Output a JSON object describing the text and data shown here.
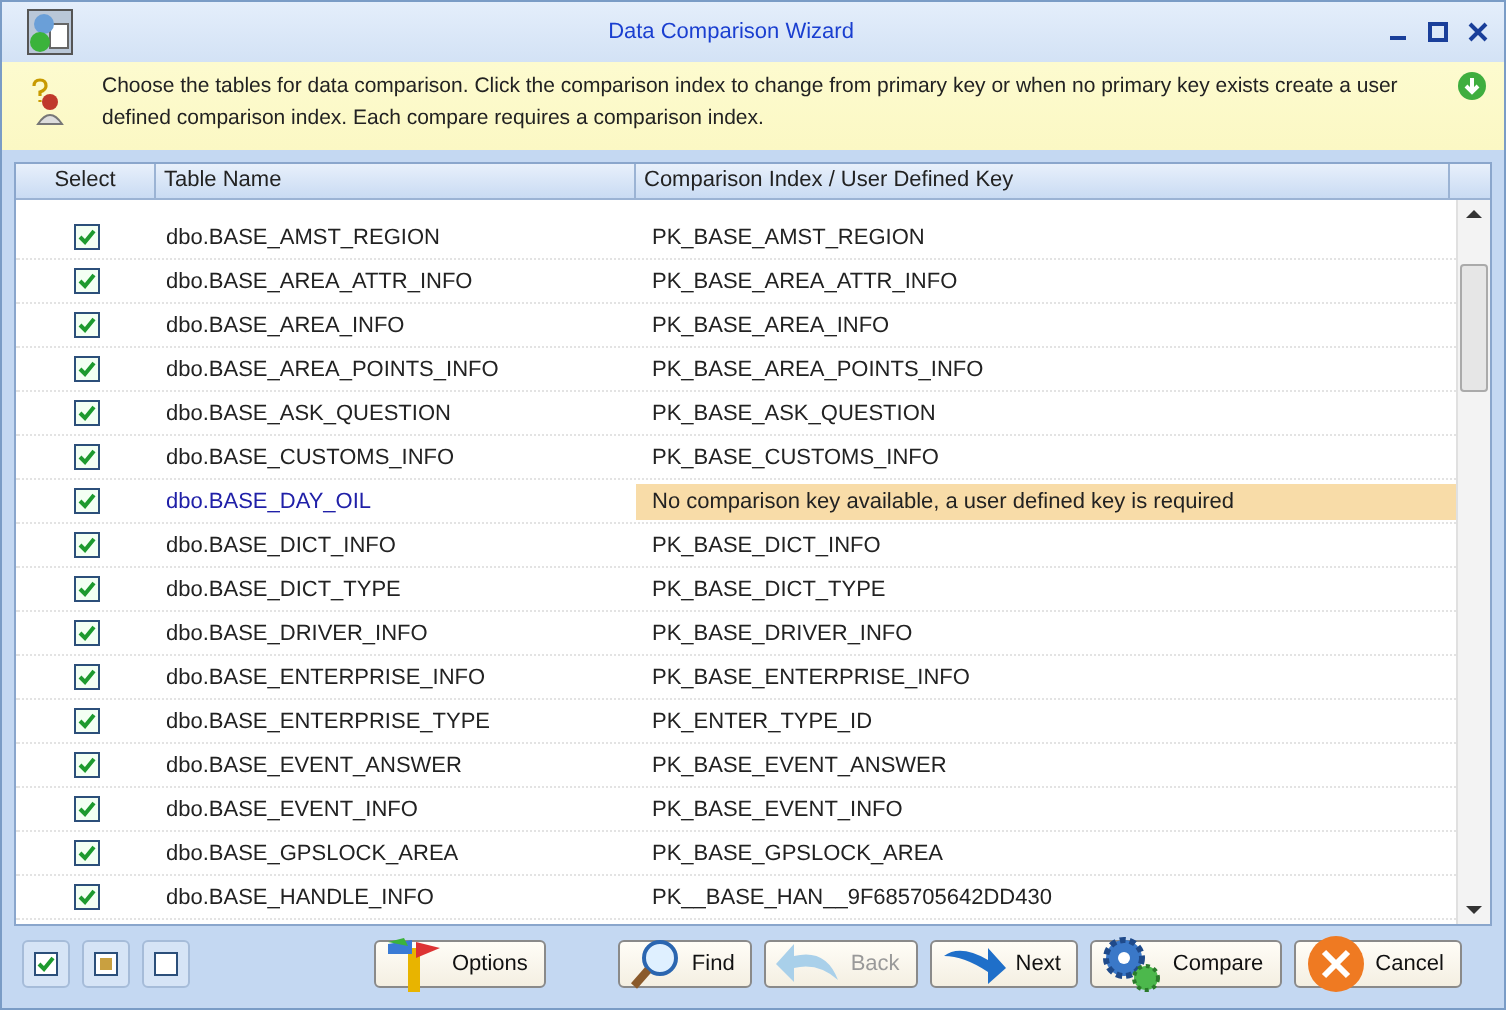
{
  "window": {
    "title": "Data Comparison Wizard"
  },
  "info": {
    "text": "Choose the tables for data comparison.  Click the comparison index to change from primary key or when no primary key exists create a user defined comparison index. Each compare requires a comparison index."
  },
  "table": {
    "columns": [
      "Select",
      "Table Name",
      "Comparison Index / User Defined Key"
    ],
    "rows": [
      {
        "checked": true,
        "has_key": true,
        "name": "dbo.BASE_AMST_REGION",
        "key": "PK_BASE_AMST_REGION"
      },
      {
        "checked": true,
        "has_key": true,
        "name": "dbo.BASE_AREA_ATTR_INFO",
        "key": "PK_BASE_AREA_ATTR_INFO"
      },
      {
        "checked": true,
        "has_key": true,
        "name": "dbo.BASE_AREA_INFO",
        "key": "PK_BASE_AREA_INFO"
      },
      {
        "checked": true,
        "has_key": true,
        "name": "dbo.BASE_AREA_POINTS_INFO",
        "key": "PK_BASE_AREA_POINTS_INFO"
      },
      {
        "checked": true,
        "has_key": true,
        "name": "dbo.BASE_ASK_QUESTION",
        "key": "PK_BASE_ASK_QUESTION"
      },
      {
        "checked": true,
        "has_key": true,
        "name": "dbo.BASE_CUSTOMS_INFO",
        "key": "PK_BASE_CUSTOMS_INFO"
      },
      {
        "checked": true,
        "has_key": false,
        "name": "dbo.BASE_DAY_OIL",
        "key": "No comparison key available, a user defined key is required"
      },
      {
        "checked": true,
        "has_key": true,
        "name": "dbo.BASE_DICT_INFO",
        "key": "PK_BASE_DICT_INFO"
      },
      {
        "checked": true,
        "has_key": true,
        "name": "dbo.BASE_DICT_TYPE",
        "key": "PK_BASE_DICT_TYPE"
      },
      {
        "checked": true,
        "has_key": true,
        "name": "dbo.BASE_DRIVER_INFO",
        "key": "PK_BASE_DRIVER_INFO"
      },
      {
        "checked": true,
        "has_key": true,
        "name": "dbo.BASE_ENTERPRISE_INFO",
        "key": "PK_BASE_ENTERPRISE_INFO"
      },
      {
        "checked": true,
        "has_key": true,
        "name": "dbo.BASE_ENTERPRISE_TYPE",
        "key": "PK_ENTER_TYPE_ID"
      },
      {
        "checked": true,
        "has_key": true,
        "name": "dbo.BASE_EVENT_ANSWER",
        "key": "PK_BASE_EVENT_ANSWER"
      },
      {
        "checked": true,
        "has_key": true,
        "name": "dbo.BASE_EVENT_INFO",
        "key": "PK_BASE_EVENT_INFO"
      },
      {
        "checked": true,
        "has_key": true,
        "name": "dbo.BASE_GPSLOCK_AREA",
        "key": "PK_BASE_GPSLOCK_AREA"
      },
      {
        "checked": true,
        "has_key": true,
        "name": "dbo.BASE_HANDLE_INFO",
        "key": "PK__BASE_HAN__9F685705642DD430"
      }
    ]
  },
  "buttons": [
    {
      "kind": "options",
      "label": "Options",
      "disabled": false
    },
    {
      "kind": "find",
      "label": "Find",
      "disabled": false
    },
    {
      "kind": "back",
      "label": "Back",
      "disabled": true
    },
    {
      "kind": "next",
      "label": "Next",
      "disabled": false
    },
    {
      "kind": "compare",
      "label": "Compare",
      "disabled": false
    },
    {
      "kind": "cancel",
      "label": "Cancel",
      "disabled": false
    }
  ]
}
